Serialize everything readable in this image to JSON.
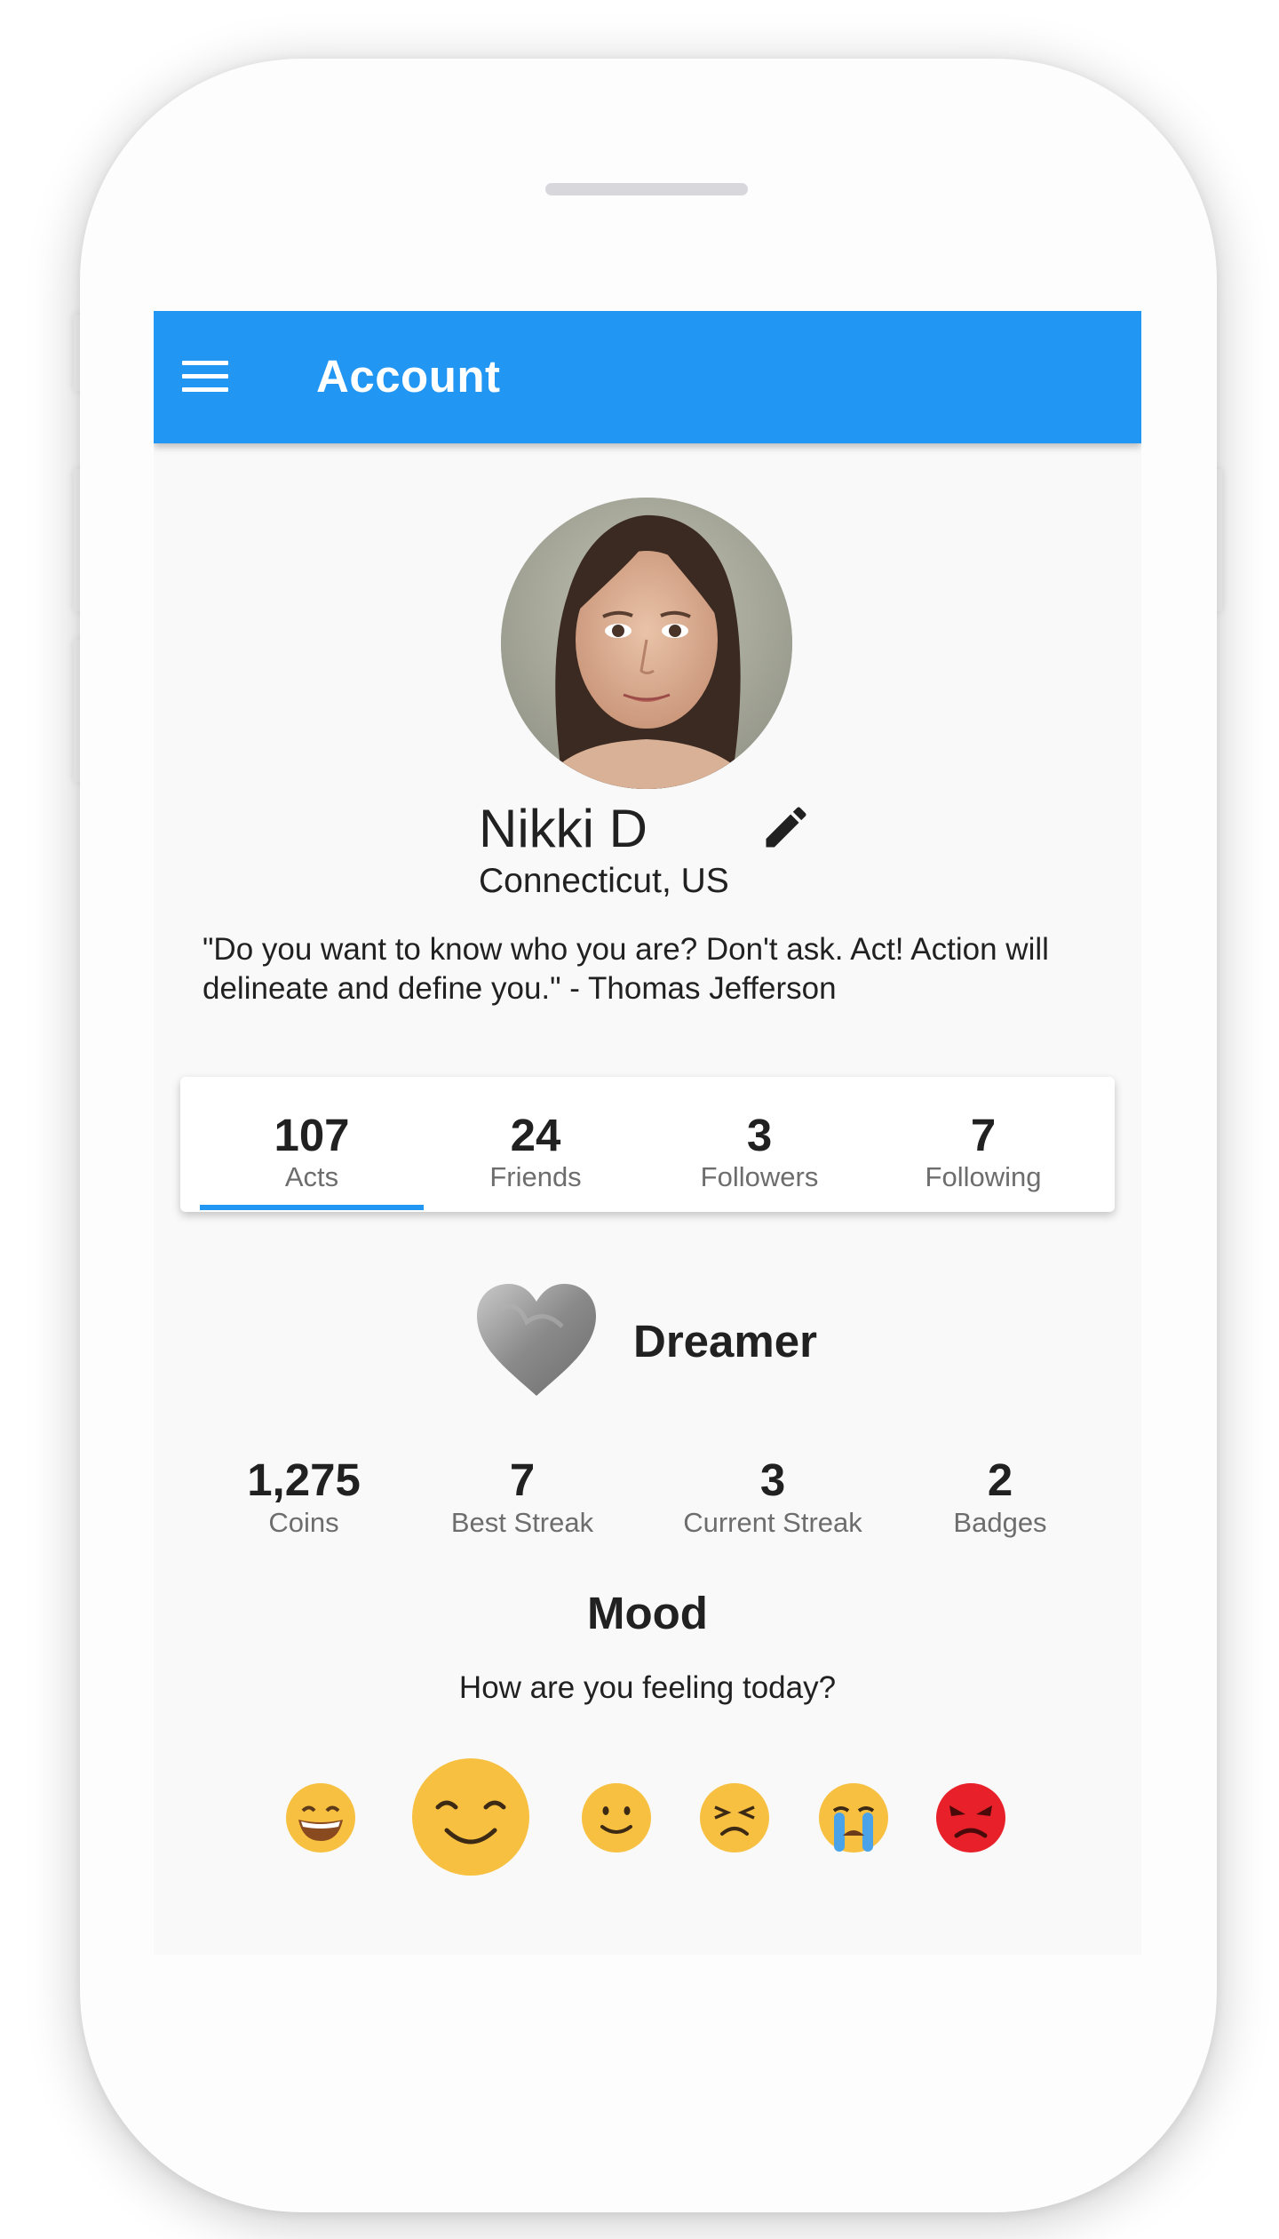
{
  "app_bar": {
    "title": "Account",
    "menu_icon": "hamburger-menu-icon"
  },
  "profile": {
    "avatar_icon": "profile-photo",
    "name": "Nikki D",
    "edit_icon": "pencil-edit-icon",
    "location": "Connecticut, US",
    "quote": "\"Do you want to know who you are? Don't ask. Act! Action will delineate and define you.\" - Thomas Jefferson"
  },
  "tabs": [
    {
      "value": "107",
      "label": "Acts",
      "selected": true
    },
    {
      "value": "24",
      "label": "Friends",
      "selected": false
    },
    {
      "value": "3",
      "label": "Followers",
      "selected": false
    },
    {
      "value": "7",
      "label": "Following",
      "selected": false
    }
  ],
  "level": {
    "icon": "gray-heart-icon",
    "name": "Dreamer"
  },
  "stats": [
    {
      "value": "1,275",
      "label": "Coins"
    },
    {
      "value": "7",
      "label": "Best Streak"
    },
    {
      "value": "3",
      "label": "Current Streak"
    },
    {
      "value": "2",
      "label": "Badges"
    }
  ],
  "mood": {
    "title": "Mood",
    "prompt": "How are you feeling today?",
    "options": [
      "grinning-face-icon",
      "smiling-face-icon",
      "slightly-smiling-face-icon",
      "persevering-face-icon",
      "crying-face-icon",
      "angry-face-icon"
    ],
    "selected": "smiling-face-icon"
  },
  "colors": {
    "primary": "#2196f3",
    "emoji_yellow": "#f7c040",
    "angry_red": "#e8202a"
  }
}
